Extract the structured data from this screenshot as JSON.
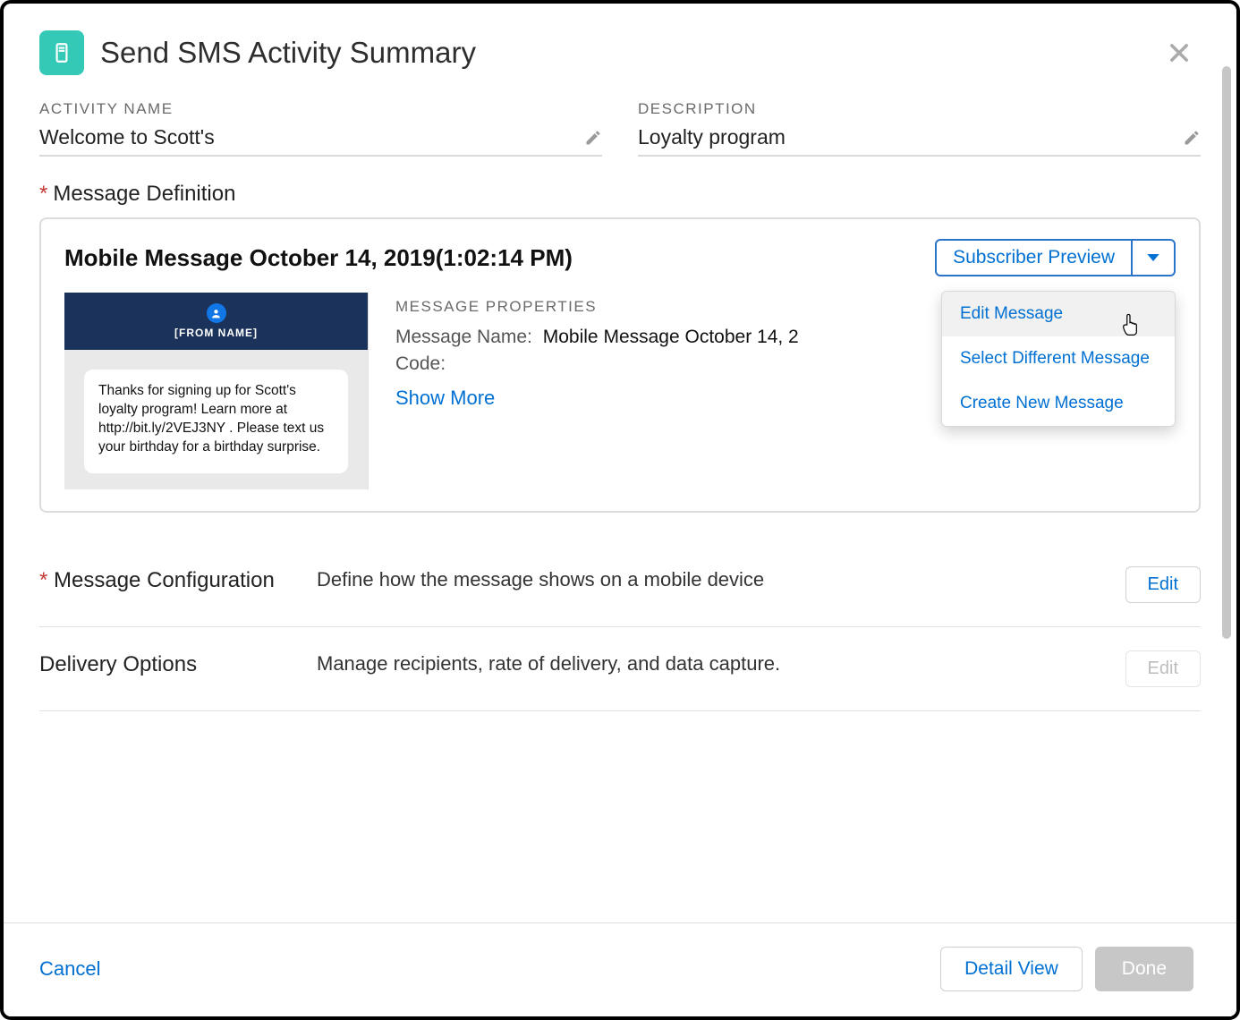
{
  "header": {
    "title": "Send SMS Activity Summary"
  },
  "fields": {
    "activity_label": "ACTIVITY NAME",
    "activity_value": "Welcome to Scott's",
    "description_label": "DESCRIPTION",
    "description_value": "Loyalty program"
  },
  "message_def": {
    "section_label": "Message Definition",
    "title": "Mobile Message October 14, 2019(1:02:14 PM)",
    "preview_button": "Subscriber Preview",
    "phone": {
      "from_name": "[FROM NAME]",
      "body": "Thanks for signing up for Scott's loyalty program! Learn more at http://bit.ly/2VEJ3NY . Please text us your birthday for a birthday surprise."
    },
    "props": {
      "heading": "MESSAGE PROPERTIES",
      "name_label": "Message Name:",
      "name_value": "Mobile Message October 14, 2",
      "code_label": "Code:",
      "code_value": "",
      "show_more": "Show More"
    },
    "dropdown": {
      "edit": "Edit Message",
      "select": "Select Different Message",
      "create": "Create New Message"
    }
  },
  "sections": {
    "config": {
      "name": "Message Configuration",
      "desc": "Define how the message shows on a mobile device",
      "btn": "Edit"
    },
    "delivery": {
      "name": "Delivery Options",
      "desc": "Manage recipients, rate of delivery, and data capture.",
      "btn": "Edit"
    }
  },
  "footer": {
    "cancel": "Cancel",
    "detail_view": "Detail View",
    "done": "Done"
  }
}
